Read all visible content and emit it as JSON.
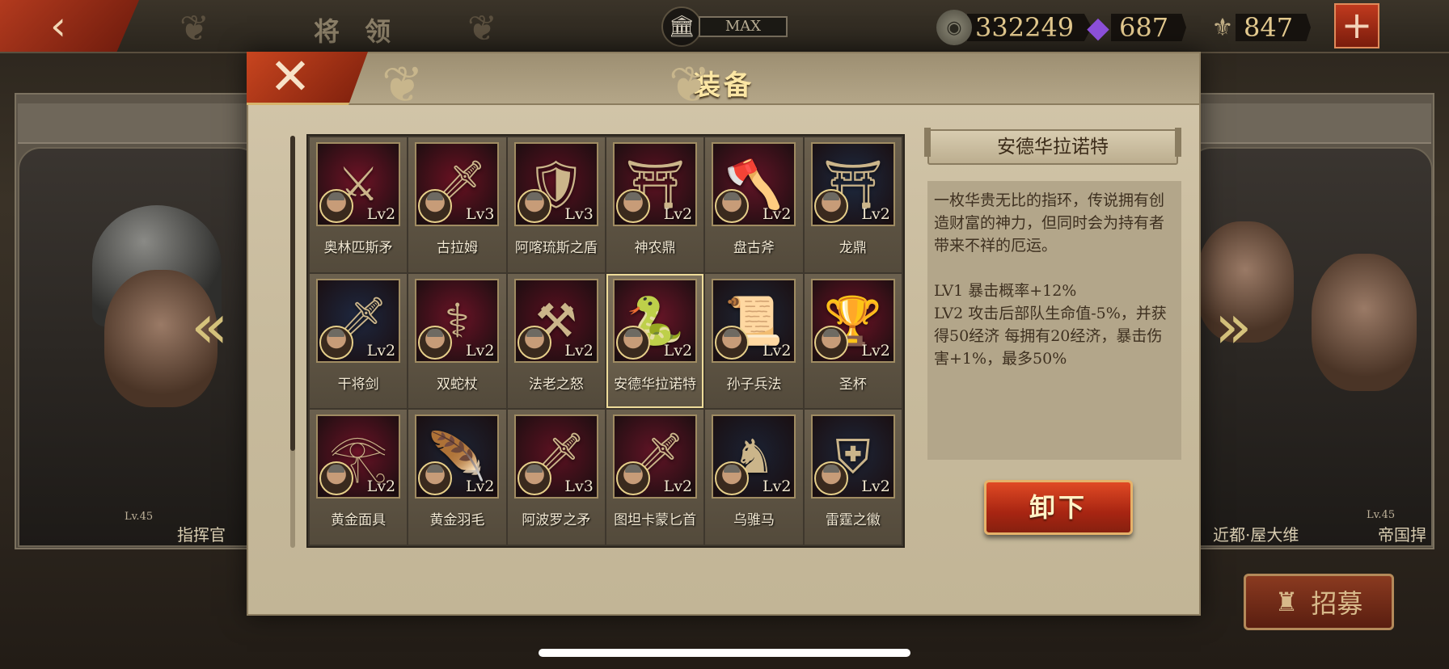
{
  "topbar": {
    "title": "将 领",
    "vip_label": "MAX",
    "resources": [
      {
        "icon": "gold-coin-icon",
        "value": "332249"
      },
      {
        "icon": "purple-gem-icon",
        "value": "687"
      },
      {
        "icon": "spqr-emblem-icon",
        "value": "847"
      }
    ]
  },
  "background": {
    "left_caption": "指挥官",
    "left_level": "Lv.45",
    "right_caption_1": "近都·屋大维",
    "right_caption_2": "帝国捍",
    "right_level": "Lv.45",
    "recruit_label": "招募"
  },
  "modal": {
    "title": "装备",
    "items": [
      {
        "name": "奥林匹斯矛",
        "level": "Lv2",
        "icon": "spear-icon",
        "glyph": "⚔",
        "bg": "#6e1326"
      },
      {
        "name": "古拉姆",
        "level": "Lv3",
        "icon": "sword-icon",
        "glyph": "🗡",
        "bg": "#6a1122"
      },
      {
        "name": "阿喀琉斯之盾",
        "level": "Lv3",
        "icon": "shield-icon",
        "glyph": "🛡",
        "bg": "#5a1020"
      },
      {
        "name": "神农鼎",
        "level": "Lv2",
        "icon": "cauldron-icon",
        "glyph": "⛩",
        "bg": "#5e1222"
      },
      {
        "name": "盘古斧",
        "level": "Lv2",
        "icon": "axe-icon",
        "glyph": "🪓",
        "bg": "#621426"
      },
      {
        "name": "龙鼎",
        "level": "Lv2",
        "icon": "dragon-cauldron-icon",
        "glyph": "⛩",
        "bg": "#1d2a40"
      },
      {
        "name": "干将剑",
        "level": "Lv2",
        "icon": "sword-icon",
        "glyph": "🗡",
        "bg": "#1e2840"
      },
      {
        "name": "双蛇杖",
        "level": "Lv2",
        "icon": "caduceus-icon",
        "glyph": "⚕",
        "bg": "#6a1326"
      },
      {
        "name": "法老之怒",
        "level": "Lv2",
        "icon": "khopesh-icon",
        "glyph": "⚒",
        "bg": "#5a1020"
      },
      {
        "name": "安德华拉诺特",
        "level": "Lv2",
        "icon": "serpent-ring-icon",
        "glyph": "🐍",
        "bg": "#6a1528"
      },
      {
        "name": "孙子兵法",
        "level": "Lv2",
        "icon": "scroll-icon",
        "glyph": "📜",
        "bg": "#1f2736"
      },
      {
        "name": "圣杯",
        "level": "Lv2",
        "icon": "chalice-icon",
        "glyph": "🏆",
        "bg": "#6e1326"
      },
      {
        "name": "黄金面具",
        "level": "Lv2",
        "icon": "golden-mask-icon",
        "glyph": "𓂀",
        "bg": "#6a1326"
      },
      {
        "name": "黄金羽毛",
        "level": "Lv2",
        "icon": "golden-wing-icon",
        "glyph": "🪶",
        "bg": "#1d2434"
      },
      {
        "name": "阿波罗之矛",
        "level": "Lv3",
        "icon": "spear-icon",
        "glyph": "🗡",
        "bg": "#5e1222"
      },
      {
        "name": "图坦卡蒙匕首",
        "level": "Lv2",
        "icon": "dagger-icon",
        "glyph": "🗡",
        "bg": "#621426"
      },
      {
        "name": "乌骓马",
        "level": "Lv2",
        "icon": "horse-icon",
        "glyph": "♞",
        "bg": "#1b2233"
      },
      {
        "name": "雷霆之徽",
        "level": "Lv2",
        "icon": "thunder-shield-icon",
        "glyph": "⛨",
        "bg": "#1e2638"
      }
    ],
    "selected_index": 9,
    "detail": {
      "name": "安德华拉诺特",
      "description": "一枚华贵无比的指环，传说拥有创造财富的神力，但同时会为持有者带来不祥的厄运。",
      "lv1": "LV1 暴击概率+12%",
      "lv2": "LV2 攻击后部队生命值-5%，并获得50经济  每拥有20经济，暴击伤害+1%，最多50%"
    },
    "unequip_label": "卸下"
  }
}
